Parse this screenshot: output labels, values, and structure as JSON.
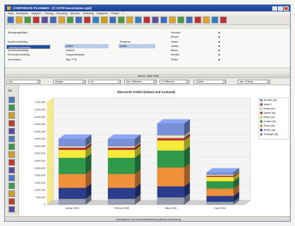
{
  "window": {
    "title": "CORPORATE PLANNER - [C:\\CP\\Praesentation.cpd]"
  },
  "menu": [
    "Datei",
    "Bearbeiten",
    "Analysen",
    "Planung",
    "Reporting",
    "Optionen",
    "Verteilung",
    "Diagramm",
    "Fenster",
    "?"
  ],
  "toolbar": {
    "icons": [
      "open-icon",
      "save-icon",
      "print-icon",
      "cut-icon",
      "copy-icon",
      "paste-icon",
      "table-icon",
      "chart-icon",
      "pie-icon",
      "bar-icon",
      "globe-icon",
      "filter-icon",
      "sort-icon",
      "calc-icon",
      "grid-icon",
      "info-icon",
      "color-icon",
      "folder-icon",
      "export-icon",
      "report-icon",
      "help-icon",
      "mail-icon",
      "print2-icon",
      "doc-icon",
      "zoom-icon",
      "close-icon"
    ],
    "colors": [
      "#3b6cc1",
      "#e0a020",
      "#4a9a40",
      "#c03030",
      "#5a4aa0",
      "#3b6cc1",
      "#e0a020",
      "#4a9a40",
      "#3b6cc1",
      "#c03030",
      "#2d80c8",
      "#d0a000",
      "#3b6cc1",
      "#4a9a40",
      "#e0a020",
      "#2d80c8",
      "#c03030",
      "#5a4aa0",
      "#3b6cc1",
      "#e0a020",
      "#4a9a40",
      "#3b6cc1",
      "#c03030",
      "#e0a020",
      "#2d80c8",
      "#c03030"
    ]
  },
  "dimensions": {
    "col1": [
      "Bewegungsbilanz",
      "",
      "Kostencontrolling",
      "Vertriebscontrolling",
      "Kundencontrolling",
      "Personalcontrolling",
      "Kennzahlen"
    ],
    "col2": [
      "",
      "",
      "",
      "Artikel",
      "Artikel2",
      "Gruppenbeispiel",
      "Bsp. FTR"
    ],
    "col3": [
      "",
      "",
      "Regionen",
      "Artikel",
      "",
      "",
      ""
    ],
    "col4": [
      "Hemden",
      "Blusen",
      "Hosen",
      "Jacken",
      "Blazer",
      "Kombis",
      "Röcke"
    ]
  },
  "period": "Januar - April 2006",
  "selectors": [
    "Zeit",
    "Budget",
    "Ist",
    "Abs. Differenz",
    "% Differenz",
    "Vorjahr",
    "abs. Eintrag"
  ],
  "chart_data": {
    "type": "bar",
    "title": "Übersicht Artikel (Inland und Ausland)",
    "categories": [
      "Januar 2006",
      "Februar 2006",
      "März 2006",
      "April 2006"
    ],
    "ylim": [
      0,
      7000000
    ],
    "yticks": [
      "0",
      "500.000",
      "1.000.000",
      "1.500.000",
      "2.000.000",
      "2.500.000",
      "3.000.000",
      "3.500.000",
      "4.000.000",
      "4.500.000",
      "5.000.000",
      "5.500.000",
      "6.000.000",
      "6.500.000",
      "7.000.000"
    ],
    "series": [
      {
        "name": "Sonstiges (Ist)",
        "color": "#9aa0b0",
        "values": [
          400000,
          400000,
          500000,
          200000
        ]
      },
      {
        "name": "Blusen (Ist)",
        "color": "#2c3c8c",
        "values": [
          750000,
          750000,
          750000,
          400000
        ]
      },
      {
        "name": "Röcke (Ist)",
        "color": "#f0903a",
        "values": [
          950000,
          950000,
          1300000,
          500000
        ]
      },
      {
        "name": "Kombis (Ist)",
        "color": "#2e9a4a",
        "values": [
          1100000,
          1100000,
          1150000,
          500000
        ]
      },
      {
        "name": "Blazer (Ist)",
        "color": "#f3ea3a",
        "values": [
          550000,
          550000,
          700000,
          300000
        ]
      },
      {
        "name": "Jacken (Ist)",
        "color": "#c03028",
        "values": [
          150000,
          150000,
          150000,
          80000
        ]
      },
      {
        "name": "Hosen (Ist)",
        "color": "#e9e8c8",
        "values": [
          100000,
          100000,
          200000,
          70000
        ]
      },
      {
        "name": "Hemden (Ist)",
        "color": "#7890d8",
        "values": [
          500000,
          500000,
          800000,
          150000
        ]
      }
    ],
    "legend": [
      {
        "name": "Hemden (Ist)",
        "color": "#7890d8"
      },
      {
        "name": "Jacke E",
        "color": "#c03028"
      },
      {
        "name": "Hosen (Ist)",
        "color": "#e9e8c8"
      },
      {
        "name": "Jacken (Ist)",
        "color": "#c03028"
      },
      {
        "name": "Blazer (Ist)",
        "color": "#f3ea3a"
      },
      {
        "name": "Kombis (Ist)",
        "color": "#2e9a4a"
      },
      {
        "name": "Röcke (Ist)",
        "color": "#f0903a"
      },
      {
        "name": "Blusen (Ist)",
        "color": "#2c3c8c"
      },
      {
        "name": "Sonstiges (Ist)",
        "color": "#9aa0b0"
      }
    ]
  },
  "status": "Automatische und benutzerdefinierte grafische Auswertung"
}
